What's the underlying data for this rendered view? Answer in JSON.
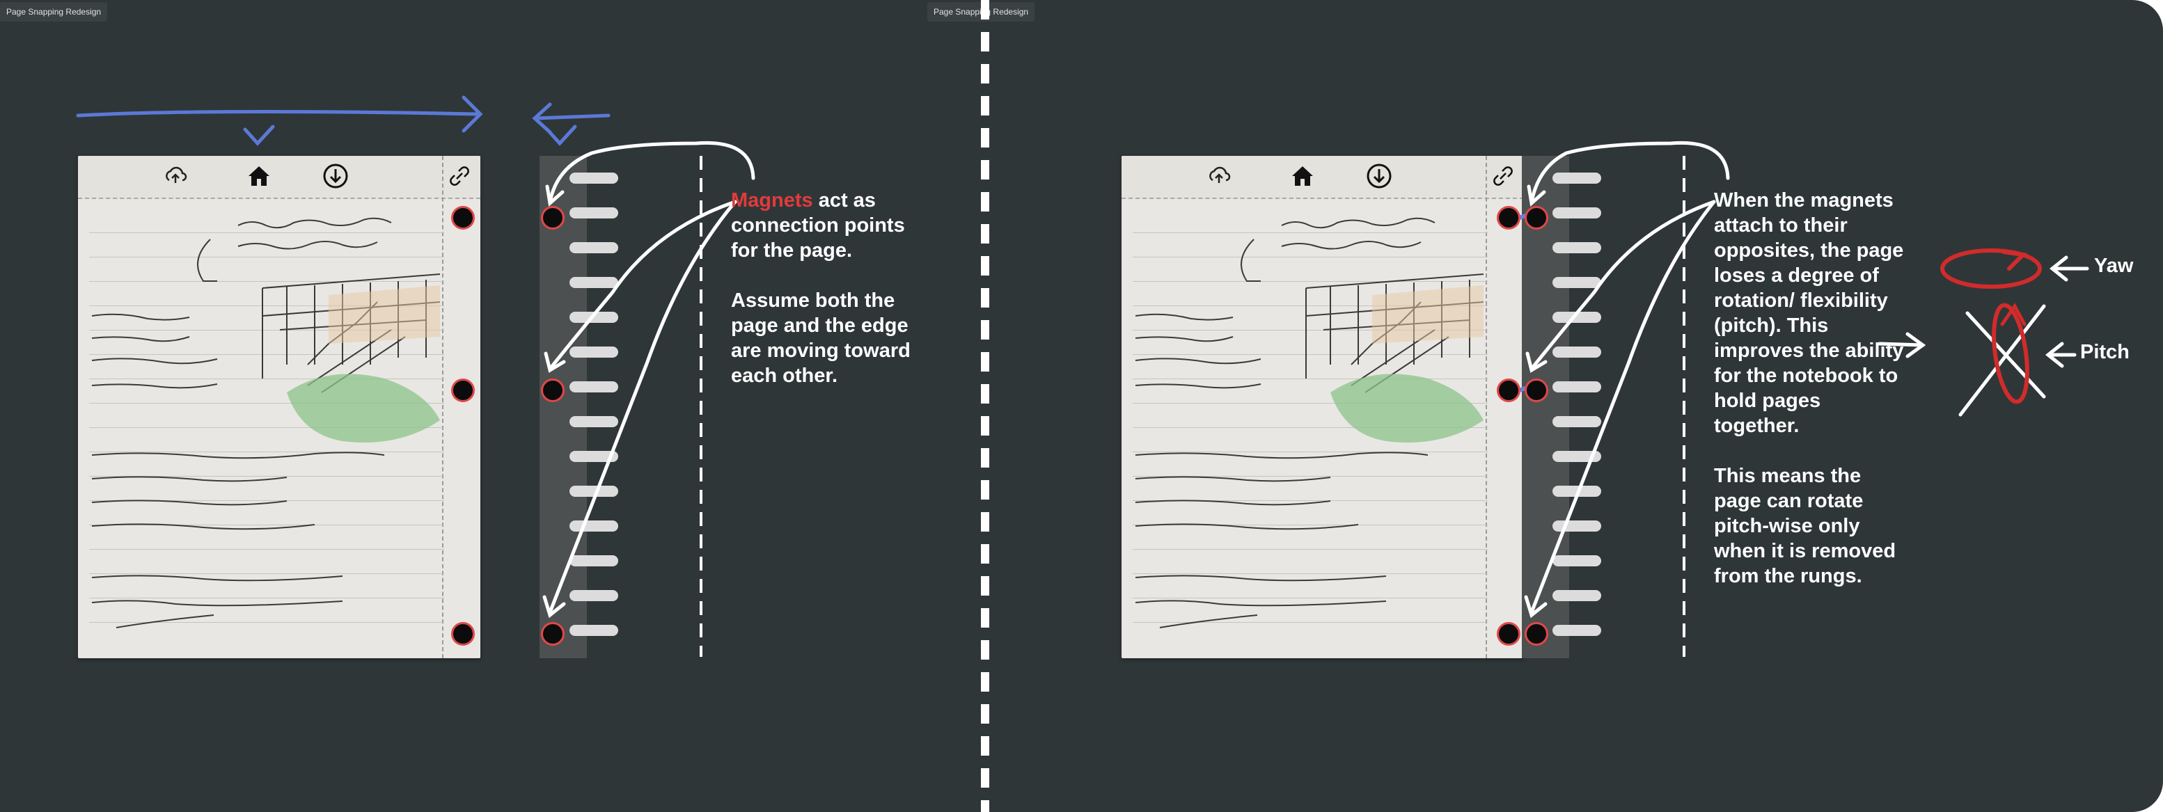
{
  "frames": {
    "left_tag": "Page Snapping Redesign",
    "right_tag": "Page Snapping Redesign"
  },
  "toolbar_icons": [
    "upload-cloud-icon",
    "home-icon",
    "download-icon",
    "link-icon"
  ],
  "notes": {
    "left": {
      "highlight": "Magnets",
      "line1_rest": " act as connection points for the page.",
      "line2": "Assume both the page and the edge are moving toward each other."
    },
    "right": {
      "paragraph1": "When the magnets attach to their opposites, the page loses a degree of rotation/ flexibility (pitch). This improves the ability for the notebook to hold pages together.",
      "paragraph2": "This means the page can rotate pitch-wise only when it is removed from the rungs."
    },
    "axes": {
      "yaw": "Yaw",
      "pitch": "Pitch"
    }
  },
  "colors": {
    "background": "#2f3638",
    "accent_blue": "#5b79d6",
    "magnet_red": "#e04848",
    "highlight_red": "#e23b3b"
  }
}
